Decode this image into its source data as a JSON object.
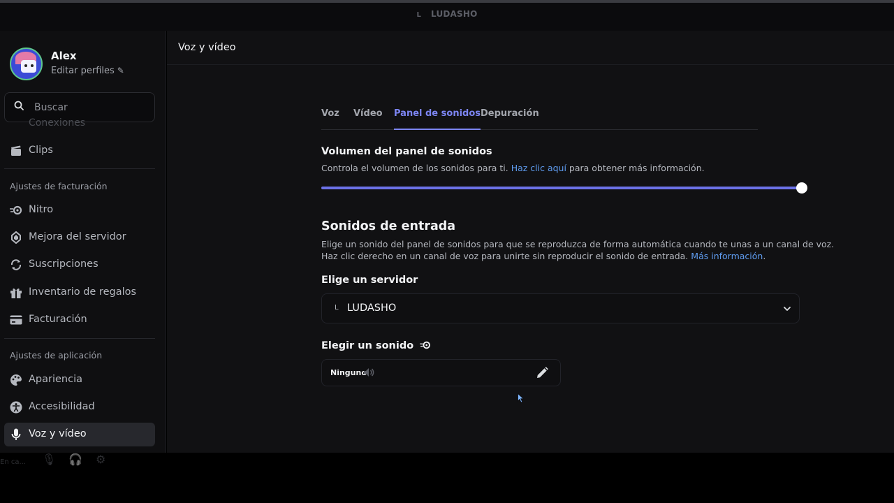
{
  "topbar": {
    "server_initial": "L",
    "server_name": "LUDASHO"
  },
  "sidebar": {
    "profile": {
      "name": "Alex",
      "edit_label": "Editar perfiles"
    },
    "search_placeholder": "Buscar",
    "faded_item": "Conexiones",
    "items_top": [
      {
        "label": "Clips",
        "icon": "clips-icon"
      }
    ],
    "billing_title": "Ajustes de facturación",
    "billing_items": [
      {
        "label": "Nitro",
        "icon": "nitro-icon"
      },
      {
        "label": "Mejora del servidor",
        "icon": "boost-icon"
      },
      {
        "label": "Suscripciones",
        "icon": "subscriptions-icon"
      },
      {
        "label": "Inventario de regalos",
        "icon": "gift-icon"
      },
      {
        "label": "Facturación",
        "icon": "credit-card-icon"
      }
    ],
    "app_title": "Ajustes de aplicación",
    "app_items": [
      {
        "label": "Apariencia",
        "icon": "palette-icon"
      },
      {
        "label": "Accesibilidad",
        "icon": "accessibility-icon"
      },
      {
        "label": "Voz y vídeo",
        "icon": "microphone-icon",
        "active": true
      }
    ],
    "footer_ghost": "En ca..."
  },
  "main": {
    "header_title": "Voz y vídeo",
    "tabs": [
      {
        "label": "Voz"
      },
      {
        "label": "Vídeo"
      },
      {
        "label": "Panel de sonidos",
        "active": true
      },
      {
        "label": "Depuración"
      }
    ],
    "volume": {
      "title": "Volumen del panel de sonidos",
      "desc_before": "Controla el volumen de los sonidos para ti. ",
      "desc_link": "Haz clic aquí",
      "desc_after": " para obtener más información.",
      "value_percent": 100
    },
    "entrance": {
      "title": "Sonidos de entrada",
      "line1": "Elige un sonido del panel de sonidos para que se reproduzca de forma automática cuando te unas a un canal de voz.",
      "line2_before": "Haz clic derecho en un canal de voz para unirte sin reproducir el sonido de entrada. ",
      "line2_link": "Más información",
      "line2_after": "."
    },
    "server_select": {
      "label": "Elige un servidor",
      "initial": "L",
      "value": "LUDASHO"
    },
    "sound_select": {
      "label": "Elegir un sonido",
      "value": "Ninguno"
    }
  },
  "colors": {
    "accent": "#7c85f2",
    "link": "#5f9cf0",
    "slider": "#6c72e8"
  }
}
